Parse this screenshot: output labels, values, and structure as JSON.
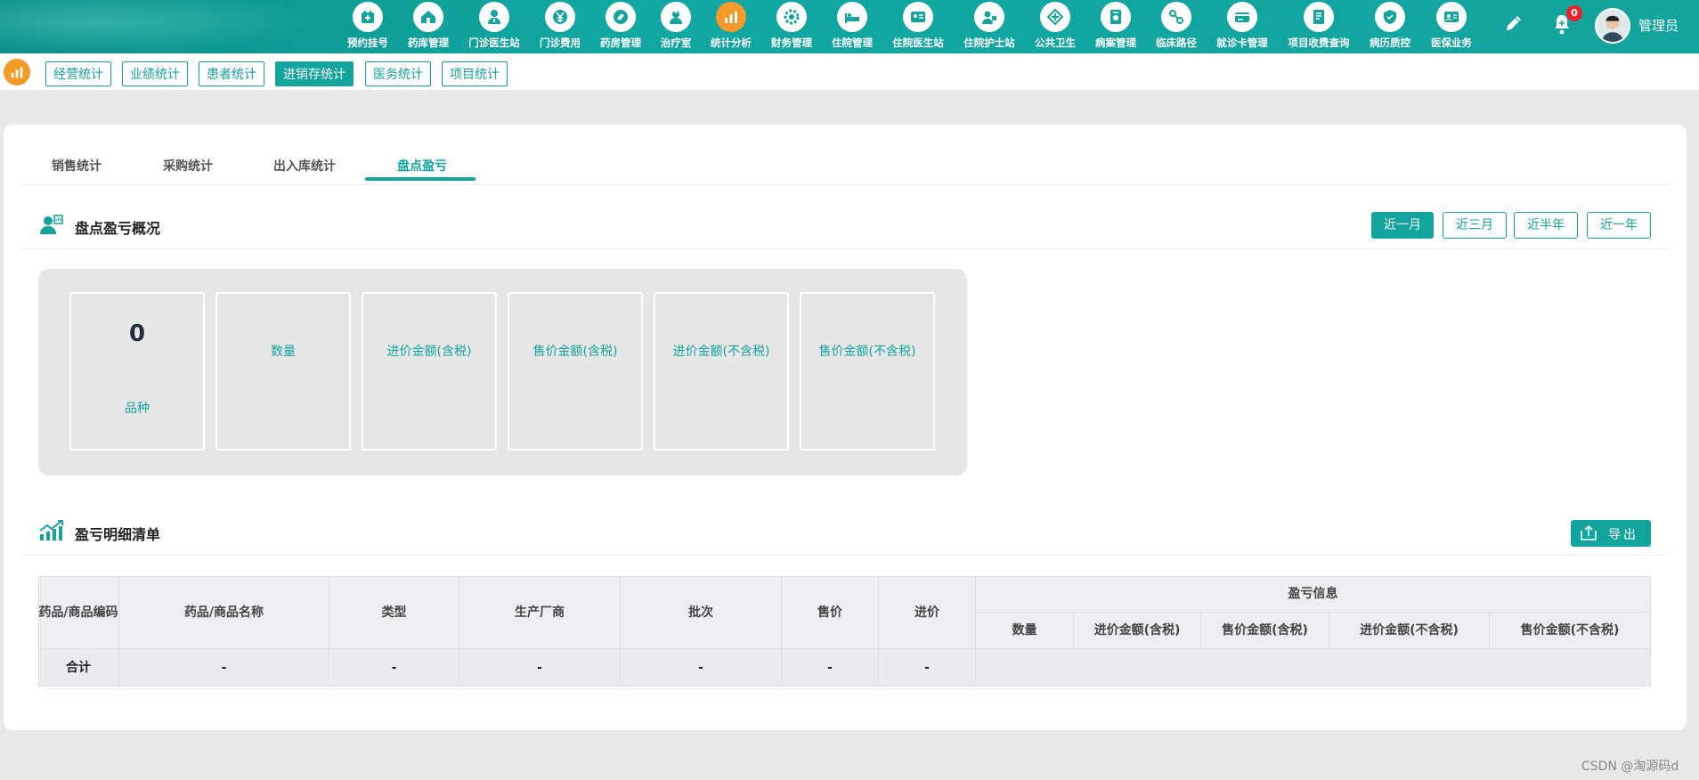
{
  "topnav": {
    "items": [
      {
        "label": "预约挂号",
        "icon": "calendar-icon"
      },
      {
        "label": "药库管理",
        "icon": "house-icon"
      },
      {
        "label": "门诊医生站",
        "icon": "doctor-icon"
      },
      {
        "label": "门诊费用",
        "icon": "yen-icon"
      },
      {
        "label": "药房管理",
        "icon": "pill-icon"
      },
      {
        "label": "治疗室",
        "icon": "nurse-icon"
      },
      {
        "label": "统计分析",
        "icon": "bar-chart-icon"
      },
      {
        "label": "财务管理",
        "icon": "gear-icon"
      },
      {
        "label": "住院管理",
        "icon": "bed-icon"
      },
      {
        "label": "住院医生站",
        "icon": "doctor-card-icon"
      },
      {
        "label": "住院护士站",
        "icon": "nurse-card-icon"
      },
      {
        "label": "公共卫生",
        "icon": "cross-icon"
      },
      {
        "label": "病案管理",
        "icon": "folder-icon"
      },
      {
        "label": "临床路径",
        "icon": "path-icon"
      },
      {
        "label": "就诊卡管理",
        "icon": "card-icon"
      },
      {
        "label": "项目收费查询",
        "icon": "receipt-icon"
      },
      {
        "label": "病历质控",
        "icon": "shield-icon"
      },
      {
        "label": "医保业务",
        "icon": "id-card-icon"
      }
    ],
    "notification_count": "0",
    "username": "管理员"
  },
  "subnav": {
    "items": [
      "经营统计",
      "业绩统计",
      "患者统计",
      "进销存统计",
      "医务统计",
      "项目统计"
    ],
    "active": "进销存统计"
  },
  "tabs": {
    "items": [
      "销售统计",
      "采购统计",
      "出入库统计",
      "盘点盈亏"
    ],
    "active": "盘点盈亏"
  },
  "overview": {
    "title": "盘点盈亏概况",
    "ranges": [
      "近一月",
      "近三月",
      "近半年",
      "近一年"
    ],
    "active_range": "近一月",
    "stats": [
      {
        "value": "0",
        "label": "品种"
      },
      {
        "value": "",
        "label": "数量"
      },
      {
        "value": "",
        "label": "进价金额(含税)"
      },
      {
        "value": "",
        "label": "售价金额(含税)"
      },
      {
        "value": "",
        "label": "进价金额(不含税)"
      },
      {
        "value": "",
        "label": "售价金额(不含税)"
      }
    ]
  },
  "detail": {
    "title": "盈亏明细清单",
    "export_label": "导出",
    "columns": {
      "code": "药品/商品编码",
      "name": "药品/商品名称",
      "type": "类型",
      "manufacturer": "生产厂商",
      "batch": "批次",
      "sale_price": "售价",
      "purchase_price": "进价",
      "group": "盈亏信息",
      "qty": "数量",
      "purchase_amt_tax": "进价金额(含税)",
      "sale_amt_tax": "售价金额(含税)",
      "purchase_amt_notax": "进价金额(不含税)",
      "sale_amt_notax": "售价金额(不含税)"
    },
    "total_row": {
      "label": "合计",
      "name": "-",
      "type": "-",
      "manufacturer": "-",
      "batch": "-",
      "sale_price": "-",
      "purchase_price": "-"
    }
  },
  "watermark": "CSDN @淘源码d",
  "colors": {
    "primary": "#13a49e",
    "accent": "#f39a2a",
    "badge": "#e8232b"
  }
}
